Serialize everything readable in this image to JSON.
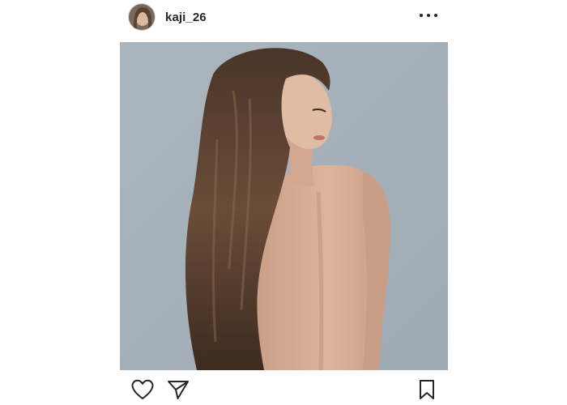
{
  "post": {
    "username": "kaji_26",
    "more_icon": "more-horizontal-icon",
    "photo_alt": "",
    "actions": {
      "like_icon": "heart-outline-icon",
      "share_icon": "paper-plane-icon",
      "save_icon": "bookmark-outline-icon"
    }
  }
}
